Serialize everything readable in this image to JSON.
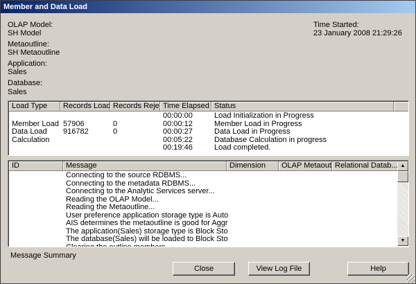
{
  "window": {
    "title": "Member and Data Load"
  },
  "info": {
    "olap_model_label": "OLAP Model:",
    "olap_model_value": "SH Model",
    "metaoutline_label": "Metaoutline:",
    "metaoutline_value": "SH Metaoutline",
    "application_label": "Application:",
    "application_value": "Sales",
    "database_label": "Database:",
    "database_value": "Sales",
    "time_started_label": "Time Started:",
    "time_started_value": "23 January 2008 21:29:26"
  },
  "status_table": {
    "columns": [
      "Load Type",
      "Records Loaded",
      "Records Rejec...",
      "Time Elapsed",
      "Status"
    ],
    "rows": [
      [
        "",
        "",
        "",
        "00:00:00",
        "Load Initialization in Progress"
      ],
      [
        "Member Load",
        "57906",
        "0",
        "00:00:12",
        "Member Load in Progress"
      ],
      [
        "Data Load",
        "916782",
        "0",
        "00:00:27",
        "Data  Load in Progress"
      ],
      [
        "Calculation",
        "",
        "",
        "00:05:22",
        "Database Calculation in progress"
      ],
      [
        "",
        "",
        "",
        "00:19:46",
        "Load completed."
      ]
    ]
  },
  "message_table": {
    "columns": [
      "ID",
      "Message",
      "Dimension",
      "OLAP Metaoutl...",
      "Relational Datab..."
    ],
    "rows": [
      [
        "",
        "Connecting to the source RDBMS...",
        "",
        "",
        ""
      ],
      [
        "",
        "Connecting to the metadata RDBMS...",
        "",
        "",
        ""
      ],
      [
        "",
        "Connecting to the Analytic Services server...",
        "",
        "",
        ""
      ],
      [
        "",
        "Reading the OLAP Model...",
        "",
        "",
        ""
      ],
      [
        "",
        "Reading the Metaoutline...",
        "",
        "",
        ""
      ],
      [
        "",
        "User preference application storage type is Auto",
        "",
        "",
        ""
      ],
      [
        "",
        "AIS determines the metaoutline is good for Aggregate Stora...",
        "",
        "",
        ""
      ],
      [
        "",
        "The application(Sales) storage type is Block Storage Type",
        "",
        "",
        ""
      ],
      [
        "",
        "The database(Sales) will be loaded to Block Storage Type ...",
        "",
        "",
        ""
      ],
      [
        "",
        "Clearing the outline members...",
        "",
        "",
        ""
      ]
    ]
  },
  "message_summary_label": "Message Summary",
  "buttons": {
    "close": "Close",
    "view_log": "View Log File",
    "help": "Help"
  },
  "icons": {
    "scroll_up": "scroll-up-arrow-icon",
    "scroll_down": "scroll-down-arrow-icon"
  },
  "colors": {
    "title_start": "#0a246a",
    "title_end": "#a6caf0",
    "face": "#d4d0c8"
  }
}
